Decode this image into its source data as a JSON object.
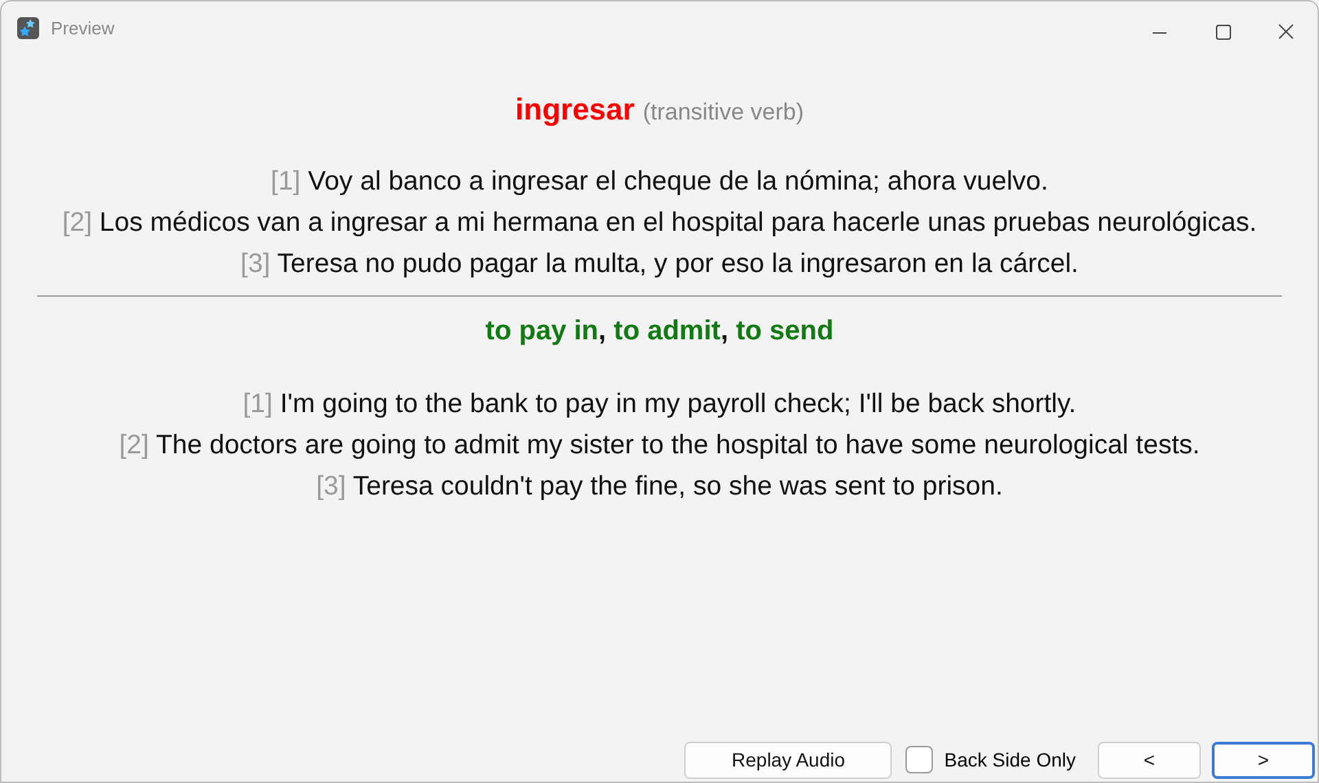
{
  "window": {
    "title": "Preview"
  },
  "headword": {
    "word": "ingresar",
    "part_of_speech": "(transitive verb)"
  },
  "source_examples": [
    {
      "number": "[1]",
      "text": "Voy al banco a ingresar el cheque de la nómina; ahora vuelvo."
    },
    {
      "number": "[2]",
      "text": "Los médicos van a ingresar a mi hermana en el hospital para hacerle unas pruebas neurológicas."
    },
    {
      "number": "[3]",
      "text": "Teresa no pudo pagar la multa, y por eso la ingresaron en la cárcel."
    }
  ],
  "translations": {
    "items": [
      "to pay in",
      "to admit",
      "to send"
    ],
    "separator": ","
  },
  "target_examples": [
    {
      "number": "[1]",
      "text": "I'm going to the bank to pay in my payroll check; I'll be back shortly."
    },
    {
      "number": "[2]",
      "text": "The doctors are going to admit my sister to the hospital to have some neurological tests."
    },
    {
      "number": "[3]",
      "text": "Teresa couldn't pay the fine, so she was sent to prison."
    }
  ],
  "footer": {
    "replay_button": "Replay Audio",
    "back_side_only": {
      "label": "Back Side Only",
      "checked": false
    },
    "prev_button": "<",
    "next_button": ">",
    "next_focused": true
  }
}
